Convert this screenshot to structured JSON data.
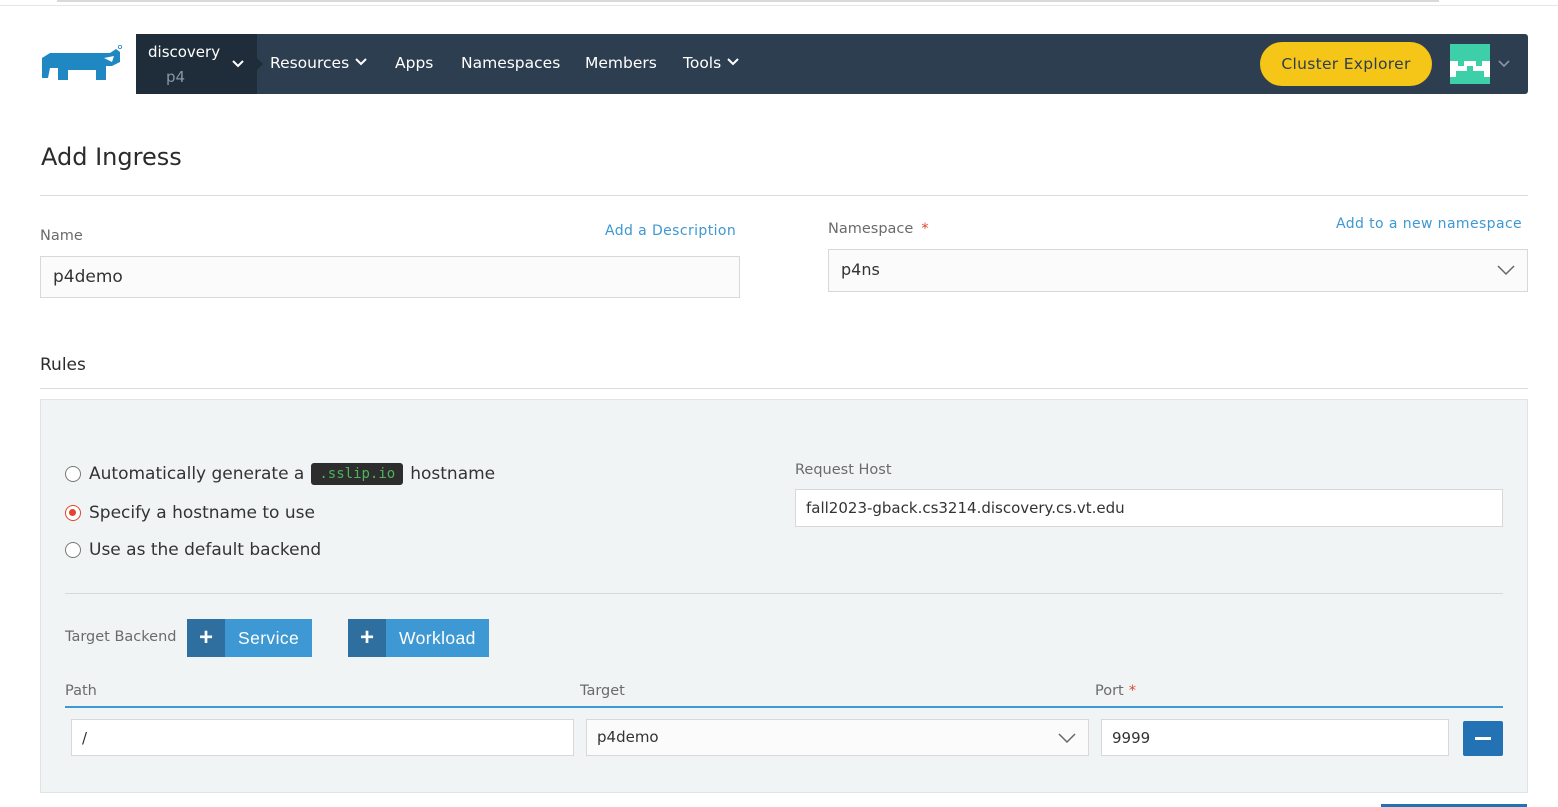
{
  "header": {
    "cluster_name": "discovery",
    "project_name": "p4",
    "nav_items": [
      {
        "label": "Resources",
        "has_menu": true
      },
      {
        "label": "Apps",
        "has_menu": false
      },
      {
        "label": "Namespaces",
        "has_menu": false
      },
      {
        "label": "Members",
        "has_menu": false
      },
      {
        "label": "Tools",
        "has_menu": true
      }
    ],
    "cluster_explorer_label": "Cluster Explorer"
  },
  "page": {
    "title": "Add Ingress"
  },
  "form": {
    "name_label": "Name",
    "name_value": "p4demo",
    "add_description_label": "Add a Description",
    "namespace_label": "Namespace",
    "namespace_required": "*",
    "namespace_value": "p4ns",
    "add_namespace_label": "Add to a new namespace"
  },
  "rules": {
    "section_title": "Rules",
    "hostname_options": {
      "auto_prefix": "Automatically generate a",
      "auto_code": ".sslip.io",
      "auto_suffix": "hostname",
      "specify": "Specify a hostname to use",
      "default_backend": "Use as the default backend",
      "selected": "specify"
    },
    "request_host_label": "Request Host",
    "request_host_value": "fall2023-gback.cs3214.discovery.cs.vt.edu",
    "target_backend_label": "Target Backend",
    "add_service_label": "Service",
    "add_workload_label": "Workload",
    "columns": {
      "path": "Path",
      "target": "Target",
      "port": "Port",
      "port_required": "*"
    },
    "row": {
      "path": "/",
      "target": "p4demo",
      "port": "9999"
    }
  },
  "colors": {
    "navbar": "#2d3e50",
    "accent_blue": "#3d98d3",
    "explorer_yellow": "#f5c518",
    "required_red": "#e0452e"
  }
}
